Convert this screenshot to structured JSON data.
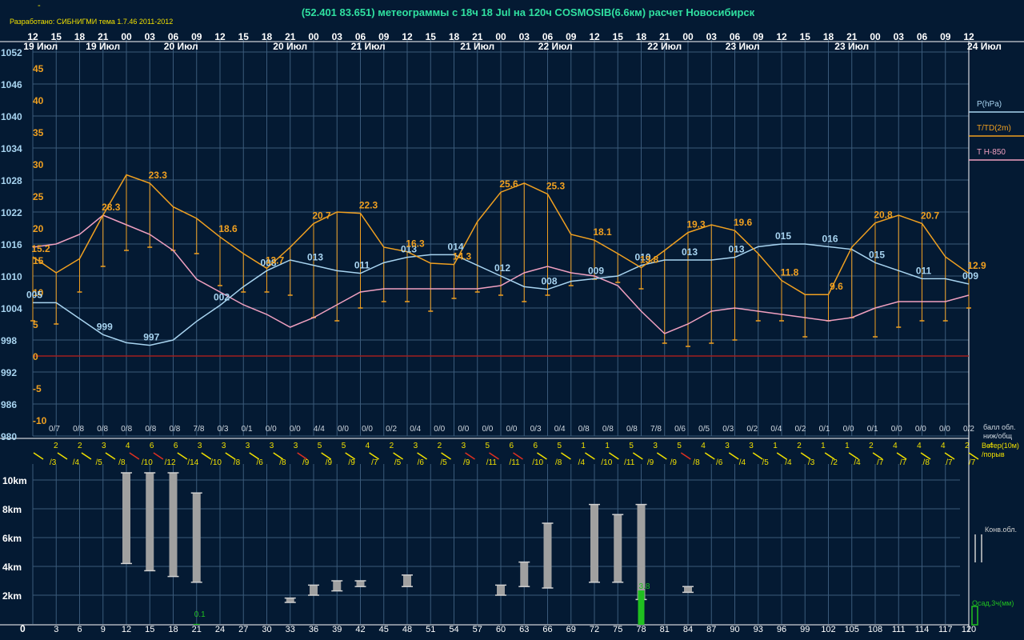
{
  "header": {
    "dash": "-",
    "developer": "Разработано: СИБНИГМИ тема 1.7.46 2011-2012",
    "title": "(52.401 83.651) метеограммы с  18ч 18 Jul на 120ч COSMOSIB(6.6км) расчет Новосибирск"
  },
  "colors": {
    "background": "#041a33",
    "grid": "#3a5a7a",
    "pressure": "#a8d4f0",
    "temperature": "#f0a020",
    "t850": "#f0a0c0",
    "zero_line": "#a02020",
    "wind_yellow": "#f0e000",
    "wind_red": "#e03020",
    "cloud_bar": "#a0a0a0",
    "precip": "#20c020"
  },
  "chart_data": [
    {
      "type": "line",
      "name": "meteogram-main",
      "time_steps_h": [
        0,
        3,
        6,
        9,
        12,
        15,
        18,
        21,
        24,
        27,
        30,
        33,
        36,
        39,
        42,
        45,
        48,
        51,
        54,
        57,
        60,
        63,
        66,
        69,
        72,
        75,
        78,
        81,
        84,
        87,
        90,
        93,
        96,
        99,
        102,
        105,
        108,
        111,
        114,
        117,
        120
      ],
      "hour_labels": [
        "12",
        "15",
        "18",
        "21",
        "00",
        "03",
        "06",
        "09",
        "12",
        "15",
        "18",
        "21",
        "00",
        "03",
        "06",
        "09",
        "12",
        "15",
        "18",
        "21",
        "00",
        "03",
        "06",
        "09",
        "12",
        "15",
        "18",
        "21",
        "00",
        "03",
        "06",
        "09",
        "12",
        "15",
        "18",
        "21",
        "00",
        "03",
        "06",
        "09",
        "12"
      ],
      "date_labels": [
        {
          "text": "19 Июл",
          "at_h": 1
        },
        {
          "text": "19 Июл",
          "at_h": 9
        },
        {
          "text": "20 Июл",
          "at_h": 19
        },
        {
          "text": "20 Июл",
          "at_h": 33
        },
        {
          "text": "21 Июл",
          "at_h": 43
        },
        {
          "text": "21 Июл",
          "at_h": 57
        },
        {
          "text": "22 Июл",
          "at_h": 67
        },
        {
          "text": "22 Июл",
          "at_h": 81
        },
        {
          "text": "23 Июл",
          "at_h": 91
        },
        {
          "text": "23 Июл",
          "at_h": 105
        },
        {
          "text": "24 Июл",
          "at_h": 122
        }
      ],
      "pressure_axis": {
        "label_ticks": [
          "1052",
          "1046",
          "1040",
          "1034",
          "1028",
          "1022",
          "1016",
          "1010",
          "1004",
          "998",
          "992",
          "986",
          "980"
        ],
        "range": [
          980,
          1052
        ]
      },
      "temp_axis": {
        "label_ticks": [
          "45",
          "40",
          "35",
          "30",
          "25",
          "20",
          "15",
          "10",
          "5",
          "0",
          "-5",
          "-10"
        ],
        "range": [
          -10,
          45
        ]
      },
      "legend": [
        {
          "text": "P(hPa)",
          "color": "#a8d4f0"
        },
        {
          "text": "T/TD(2m)",
          "color": "#f0a020"
        },
        {
          "text": "T H-850",
          "color": "#f0a0c0"
        }
      ],
      "series": [
        {
          "name": "P(hPa)",
          "values": [
            1005,
            1005,
            1002,
            999,
            997.5,
            997,
            998,
            1001.5,
            1004.5,
            1008,
            1011,
            1013,
            1012,
            1011,
            1010.5,
            1012.5,
            1013.5,
            1014,
            1014,
            1012,
            1010,
            1008,
            1007.5,
            1009,
            1009.5,
            1010,
            1012,
            1013,
            1013,
            1013,
            1013.5,
            1015.5,
            1016,
            1016,
            1015.5,
            1015,
            1012.5,
            1011,
            1009.5,
            1009.5,
            1008.5
          ]
        },
        {
          "name": "T/TD(2m)",
          "values": [
            15.5,
            13,
            15.2,
            22,
            28.3,
            27,
            23.3,
            21.5,
            18.6,
            16,
            13.7,
            17,
            20.7,
            22.5,
            22.3,
            17,
            16.3,
            14.5,
            14.3,
            21,
            25.6,
            27,
            25.3,
            19,
            18.1,
            16,
            13.8,
            16.5,
            19.3,
            20.5,
            19.6,
            16,
            11.8,
            9.6,
            9.6,
            17,
            20.8,
            22,
            20.7,
            15.5,
            12.9
          ]
        },
        {
          "name": "TD(2m)",
          "values": [
            5.5,
            5,
            10,
            14,
            16.5,
            17,
            16.5,
            16,
            11,
            10,
            10,
            9.5,
            6,
            5.5,
            7.5,
            8.5,
            8.5,
            7,
            9,
            10,
            9.5,
            8.5,
            9.5,
            11,
            12,
            11.5,
            10.5,
            2,
            1.5,
            2,
            2.5,
            5.5,
            5.5,
            3,
            5.5,
            6,
            3,
            4.5,
            5.5,
            5.5,
            7.5
          ]
        },
        {
          "name": "T H-850",
          "values": [
            17,
            17.5,
            19,
            22,
            20.5,
            19,
            16.5,
            12,
            10,
            8,
            6.5,
            4.5,
            6,
            8,
            10,
            10.5,
            10.5,
            10.5,
            10.5,
            10.5,
            11,
            13,
            14,
            13,
            12.5,
            11,
            7,
            3.5,
            5,
            7,
            7.5,
            7,
            6.5,
            6,
            5.5,
            6,
            7.5,
            8.5,
            8.5,
            8.5,
            9.5
          ]
        }
      ],
      "point_labels": {
        "pressure": [
          {
            "at_h": 3,
            "text": "005"
          },
          {
            "at_h": 12,
            "text": "999"
          },
          {
            "at_h": 18,
            "text": "997"
          },
          {
            "at_h": 27,
            "text": "002"
          },
          {
            "at_h": 33,
            "text": "008"
          },
          {
            "at_h": 39,
            "text": "013"
          },
          {
            "at_h": 45,
            "text": "011"
          },
          {
            "at_h": 51,
            "text": "013"
          },
          {
            "at_h": 57,
            "text": "014"
          },
          {
            "at_h": 63,
            "text": "012"
          },
          {
            "at_h": 69,
            "text": "008"
          },
          {
            "at_h": 75,
            "text": "009"
          },
          {
            "at_h": 81,
            "text": "010"
          },
          {
            "at_h": 87,
            "text": "013"
          },
          {
            "at_h": 93,
            "text": "013"
          },
          {
            "at_h": 99,
            "text": "015"
          },
          {
            "at_h": 105,
            "text": "016"
          },
          {
            "at_h": 111,
            "text": "015"
          },
          {
            "at_h": 117,
            "text": "011"
          },
          {
            "at_h": 123,
            "text": "009"
          }
        ],
        "temperature": [
          {
            "at_h": 6,
            "text": "15.2"
          },
          {
            "at_h": 15,
            "text": "28.3"
          },
          {
            "at_h": 21,
            "text": "23.3"
          },
          {
            "at_h": 30,
            "text": "18.6"
          },
          {
            "at_h": 36,
            "text": "13.7"
          },
          {
            "at_h": 42,
            "text": "20.7"
          },
          {
            "at_h": 48,
            "text": "22.3"
          },
          {
            "at_h": 54,
            "text": "16.3"
          },
          {
            "at_h": 60,
            "text": "14.3"
          },
          {
            "at_h": 66,
            "text": "25.6"
          },
          {
            "at_h": 72,
            "text": "25.3"
          },
          {
            "at_h": 78,
            "text": "18.1"
          },
          {
            "at_h": 84,
            "text": "13.8"
          },
          {
            "at_h": 90,
            "text": "19.3"
          },
          {
            "at_h": 96,
            "text": "19.6"
          },
          {
            "at_h": 102,
            "text": "11.8"
          },
          {
            "at_h": 108,
            "text": "9.6"
          },
          {
            "at_h": 114,
            "text": "20.8"
          },
          {
            "at_h": 120,
            "text": "20.7"
          },
          {
            "at_h": 126,
            "text": "12.9"
          }
        ]
      },
      "cloud_cover": [
        "0/7",
        "0/8",
        "0/8",
        "0/8",
        "0/8",
        "0/8",
        "7/8",
        "0/3",
        "0/1",
        "0/0",
        "0/0",
        "4/4",
        "0/0",
        "0/0",
        "0/2",
        "0/4",
        "0/0",
        "0/0",
        "0/0",
        "0/0",
        "0/3",
        "0/4",
        "0/8",
        "0/8",
        "0/8",
        "7/8",
        "0/6",
        "0/5",
        "0/3",
        "0/2",
        "0/4",
        "0/2",
        "0/1",
        "0/0",
        "0/1",
        "0/0",
        "0/0",
        "0/0",
        "0/2"
      ],
      "cloud_cover_label": [
        "балл обл.",
        "ниж/общ"
      ]
    },
    {
      "type": "wind",
      "label": [
        "Ветер(10м)",
        "/порыв"
      ],
      "speed": [
        "2",
        "2",
        "3",
        "4",
        "6",
        "6",
        "3",
        "3",
        "3",
        "3",
        "3",
        "5",
        "5",
        "4",
        "2",
        "3",
        "2",
        "3",
        "5",
        "6",
        "6",
        "5",
        "1",
        "1",
        "5",
        "3",
        "5",
        "4",
        "3",
        "3",
        "1",
        "2",
        "1",
        "1",
        "2",
        "4",
        "4",
        "4",
        "2",
        "4"
      ],
      "gust": [
        "/3",
        "/4",
        "/5",
        "/8",
        "/10",
        "/12",
        "/14",
        "/10",
        "/8",
        "/6",
        "/8",
        "/9",
        "/9",
        "/9",
        "/7",
        "/5",
        "/6",
        "/5",
        "/9",
        "/11",
        "/11",
        "/10",
        "/8",
        "/4",
        "/10",
        "/11",
        "/9",
        "/9",
        "/8",
        "/6",
        "/4",
        "/5",
        "/4",
        "/3",
        "/2",
        "/4",
        "/7",
        "/7",
        "/8",
        "/7",
        "/7"
      ]
    },
    {
      "type": "bar",
      "y_axis_labels": [
        "10km",
        "8km",
        "6km",
        "4km",
        "2km",
        "0"
      ],
      "ylim": [
        0,
        11
      ],
      "conv_label": "Конв.обл.",
      "precip_label": "Осад,3ч(мм)",
      "x_labels": [
        "3",
        "6",
        "9",
        "12",
        "15",
        "18",
        "21",
        "24",
        "27",
        "30",
        "33",
        "36",
        "39",
        "42",
        "45",
        "48",
        "51",
        "54",
        "57",
        "60",
        "63",
        "66",
        "69",
        "72",
        "75",
        "78",
        "81",
        "84",
        "87",
        "90",
        "93",
        "96",
        "99",
        "102",
        "105",
        "108",
        "111",
        "114",
        "117",
        "120"
      ],
      "clouds_km": [
        {
          "at_h": 12,
          "base": 4.2,
          "top": 10.5
        },
        {
          "at_h": 15,
          "base": 3.7,
          "top": 10.5
        },
        {
          "at_h": 18,
          "base": 3.3,
          "top": 10.5
        },
        {
          "at_h": 21,
          "base": 2.9,
          "top": 9.1
        },
        {
          "at_h": 33,
          "base": 1.5,
          "top": 1.8
        },
        {
          "at_h": 36,
          "base": 2.0,
          "top": 2.7
        },
        {
          "at_h": 39,
          "base": 2.3,
          "top": 3.0
        },
        {
          "at_h": 42,
          "base": 2.6,
          "top": 3.0
        },
        {
          "at_h": 48,
          "base": 2.6,
          "top": 3.4
        },
        {
          "at_h": 60,
          "base": 2.0,
          "top": 2.7
        },
        {
          "at_h": 63,
          "base": 2.6,
          "top": 4.3
        },
        {
          "at_h": 66,
          "base": 2.5,
          "top": 7.0
        },
        {
          "at_h": 72,
          "base": 2.9,
          "top": 8.3
        },
        {
          "at_h": 75,
          "base": 2.9,
          "top": 7.6
        },
        {
          "at_h": 78,
          "base": 1.7,
          "top": 8.3
        },
        {
          "at_h": 84,
          "base": 2.2,
          "top": 2.6
        }
      ],
      "precip": [
        {
          "at_h": 21,
          "value": 0.1,
          "text": "0.1"
        },
        {
          "at_h": 78,
          "value": 3.8,
          "text": "3.8"
        }
      ]
    }
  ]
}
